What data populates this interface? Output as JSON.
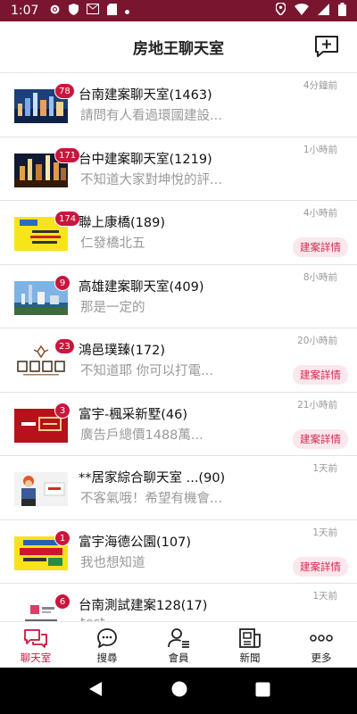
{
  "status": {
    "time": "1:07"
  },
  "header": {
    "title": "房地王聊天室"
  },
  "colors": {
    "brand": "#7a1530",
    "accent": "#c8163d",
    "detail_bg": "#fce8ec"
  },
  "chats": [
    {
      "name": "台南建案聊天室(1463)",
      "preview": "請問有人看過環國建設...",
      "time": "4分鐘前",
      "badge": "78",
      "detail": "",
      "thumb": "city-night"
    },
    {
      "name": "台中建案聊天室(1219)",
      "preview": "不知道大家對坤悅的評...",
      "time": "1小時前",
      "badge": "171",
      "detail": "",
      "thumb": "city-night-2"
    },
    {
      "name": "聯上康橋(189)",
      "preview": "仁發橋北五",
      "time": "4小時前",
      "badge": "174",
      "detail": "建案詳情",
      "thumb": "yellow-ad"
    },
    {
      "name": "高雄建案聊天室(409)",
      "preview": "那是一定的",
      "time": "8小時前",
      "badge": "9",
      "detail": "",
      "thumb": "harbor"
    },
    {
      "name": "鴻邑璞臻(172)",
      "preview": "不知道耶 你可以打電...",
      "time": "20小時前",
      "badge": "23",
      "detail": "建案詳情",
      "thumb": "logo-hongyi"
    },
    {
      "name": "富宇-楓采新墅(46)",
      "preview": "廣告戶總價1488萬...",
      "time": "21小時前",
      "badge": "3",
      "detail": "建案詳情",
      "thumb": "red-ad"
    },
    {
      "name": "**居家綜合聊天室 ...(90)",
      "preview": "不客氣哦！希望有機會...",
      "time": "1天前",
      "badge": "",
      "detail": "",
      "thumb": "worker"
    },
    {
      "name": "富宇海德公園(107)",
      "preview": "我也想知道",
      "time": "1天前",
      "badge": "1",
      "detail": "建案詳情",
      "thumb": "yellow-ad-2"
    },
    {
      "name": "台南測試建案128(17)",
      "preview": "test",
      "time": "1天前",
      "badge": "6",
      "detail": "",
      "thumb": "test-logo"
    }
  ],
  "tabs": [
    {
      "label": "聊天室",
      "icon": "chat-bubbles-icon",
      "active": true
    },
    {
      "label": "搜尋",
      "icon": "search-chat-icon",
      "active": false
    },
    {
      "label": "會員",
      "icon": "member-icon",
      "active": false
    },
    {
      "label": "新聞",
      "icon": "news-icon",
      "active": false
    },
    {
      "label": "更多",
      "icon": "more-dots-icon",
      "active": false
    }
  ]
}
